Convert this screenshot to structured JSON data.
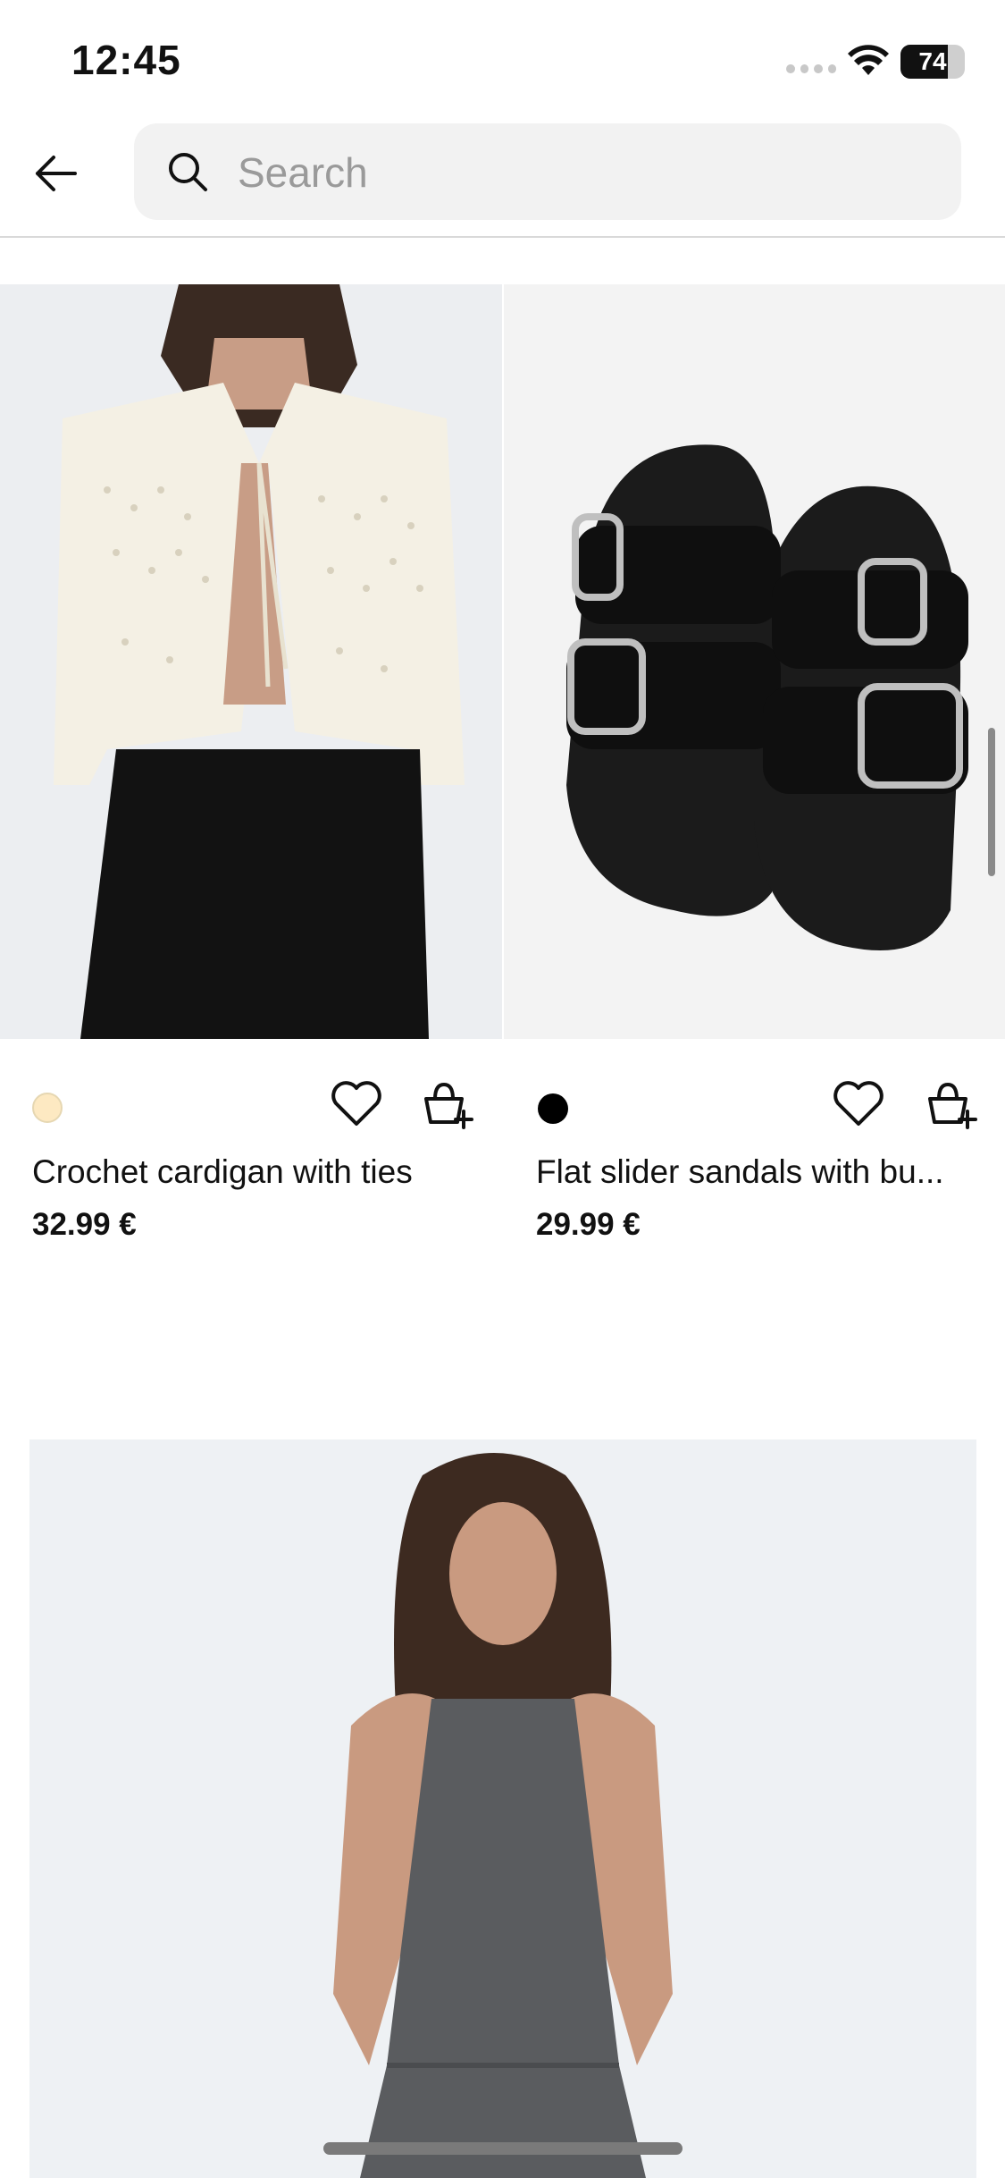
{
  "status_bar": {
    "time": "12:45",
    "battery": "74"
  },
  "search": {
    "placeholder": "Search",
    "value": ""
  },
  "products": [
    {
      "name": "Crochet cardigan with ties",
      "price": "32.99 €",
      "swatch_color": "#fde9c2"
    },
    {
      "name": "Flat slider sandals with bu...",
      "price": "29.99 €",
      "swatch_color": "#000000"
    }
  ],
  "icons": {
    "back": "arrow-left-icon",
    "search": "search-icon",
    "favorite": "heart-icon",
    "add_to_cart": "cart-plus-icon"
  }
}
